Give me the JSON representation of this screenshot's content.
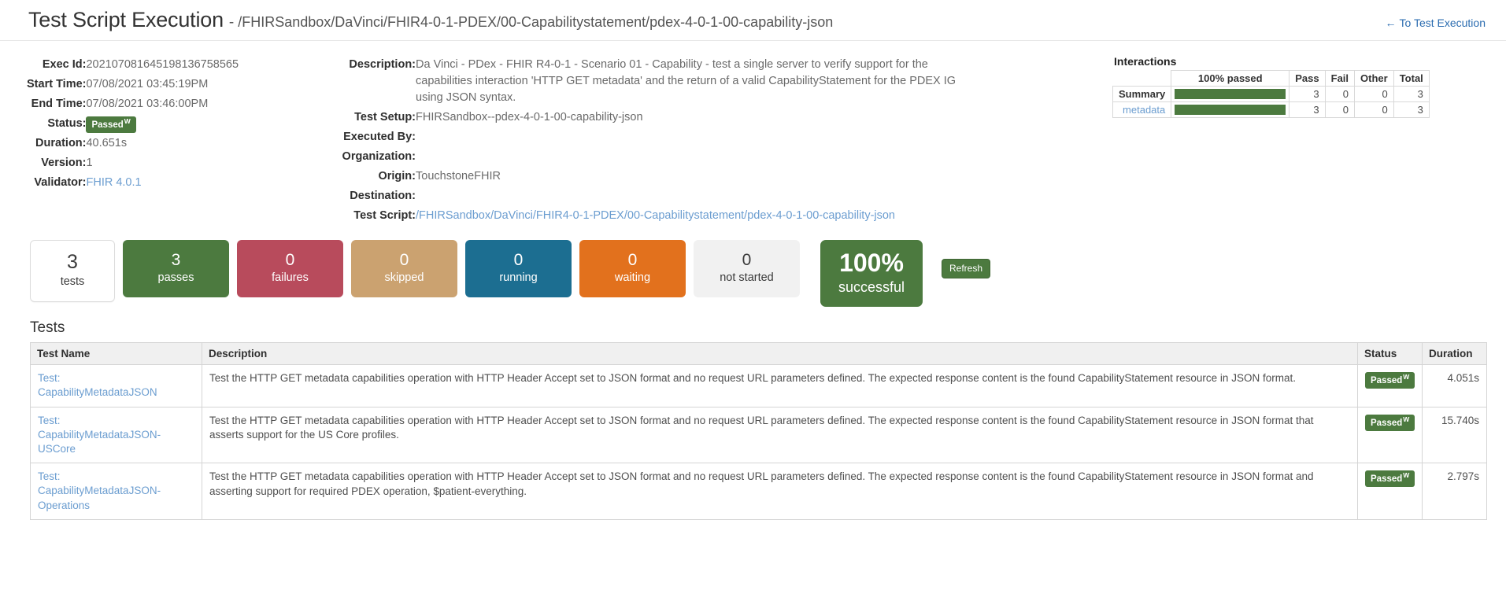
{
  "header": {
    "title": "Test Script Execution",
    "separator": "-",
    "path": "/FHIRSandbox/DaVinci/FHIR4-0-1-PDEX/00-Capabilitystatement/pdex-4-0-1-00-capability-json",
    "back_link": "To Test Execution",
    "back_arrow": "←"
  },
  "details_left": {
    "exec_id_label": "Exec Id:",
    "exec_id": "202107081645198136758565",
    "start_time_label": "Start Time:",
    "start_time": "07/08/2021 03:45:19PM",
    "end_time_label": "End Time:",
    "end_time": "07/08/2021 03:46:00PM",
    "status_label": "Status:",
    "status": "Passed",
    "status_sup": "W",
    "duration_label": "Duration:",
    "duration": "40.651s",
    "version_label": "Version:",
    "version": "1",
    "validator_label": "Validator:",
    "validator": "FHIR 4.0.1"
  },
  "details_mid": {
    "description_label": "Description:",
    "description": "Da Vinci - PDex - FHIR R4-0-1 - Scenario 01 - Capability - test a single server to verify support for the capabilities interaction 'HTTP GET metadata' and the return of a valid CapabilityStatement for the PDEX IG using JSON syntax.",
    "test_setup_label": "Test Setup:",
    "test_setup": "FHIRSandbox--pdex-4-0-1-00-capability-json",
    "executed_by_label": "Executed By:",
    "executed_by": "",
    "organization_label": "Organization:",
    "organization": "",
    "origin_label": "Origin:",
    "origin": "TouchstoneFHIR",
    "destination_label": "Destination:",
    "destination": "",
    "test_script_label": "Test Script:",
    "test_script": "/FHIRSandbox/DaVinci/FHIR4-0-1-PDEX/00-Capabilitystatement/pdex-4-0-1-00-capability-json"
  },
  "interactions": {
    "title": "Interactions",
    "columns": [
      "",
      "100% passed",
      "Pass",
      "Fail",
      "Other",
      "Total"
    ],
    "rows": [
      {
        "label": "Summary",
        "is_link": false,
        "bar_pct": 100,
        "pass": "3",
        "fail": "0",
        "other": "0",
        "total": "3"
      },
      {
        "label": "metadata",
        "is_link": true,
        "bar_pct": 100,
        "pass": "3",
        "fail": "0",
        "other": "0",
        "total": "3"
      }
    ]
  },
  "stats": [
    {
      "key": "tests",
      "num": "3",
      "label": "tests",
      "color": "#ffffff"
    },
    {
      "key": "passes",
      "num": "3",
      "label": "passes",
      "color": "#4c7a3f"
    },
    {
      "key": "failures",
      "num": "0",
      "label": "failures",
      "color": "#b84b5c"
    },
    {
      "key": "skipped",
      "num": "0",
      "label": "skipped",
      "color": "#cba270"
    },
    {
      "key": "running",
      "num": "0",
      "label": "running",
      "color": "#1c6e91"
    },
    {
      "key": "waiting",
      "num": "0",
      "label": "waiting",
      "color": "#e2711d"
    },
    {
      "key": "not_started",
      "num": "0",
      "label": "not started",
      "color": "#f1f1f1"
    }
  ],
  "percent_box": {
    "value": "100%",
    "label": "successful",
    "color": "#4c7a3f"
  },
  "refresh_button": "Refresh",
  "tests_section": {
    "heading": "Tests",
    "columns": {
      "name": "Test Name",
      "description": "Description",
      "status": "Status",
      "duration": "Duration"
    },
    "rows": [
      {
        "name_prefix": "Test:",
        "name": "CapabilityMetadataJSON",
        "description": "Test the HTTP GET metadata capabilities operation with HTTP Header Accept set to JSON format and no request URL parameters defined. The expected response content is the found CapabilityStatement resource in JSON format.",
        "status": "Passed",
        "status_sup": "W",
        "duration": "4.051s"
      },
      {
        "name_prefix": "Test:",
        "name": "CapabilityMetadataJSON-USCore",
        "description": "Test the HTTP GET metadata capabilities operation with HTTP Header Accept set to JSON format and no request URL parameters defined. The expected response content is the found CapabilityStatement resource in JSON format that asserts support for the US Core profiles.",
        "status": "Passed",
        "status_sup": "W",
        "duration": "15.740s"
      },
      {
        "name_prefix": "Test:",
        "name": "CapabilityMetadataJSON-Operations",
        "description": "Test the HTTP GET metadata capabilities operation with HTTP Header Accept set to JSON format and no request URL parameters defined. The expected response content is the found CapabilityStatement resource in JSON format and asserting support for required PDEX operation, $patient-everything.",
        "status": "Passed",
        "status_sup": "W",
        "duration": "2.797s"
      }
    ]
  }
}
